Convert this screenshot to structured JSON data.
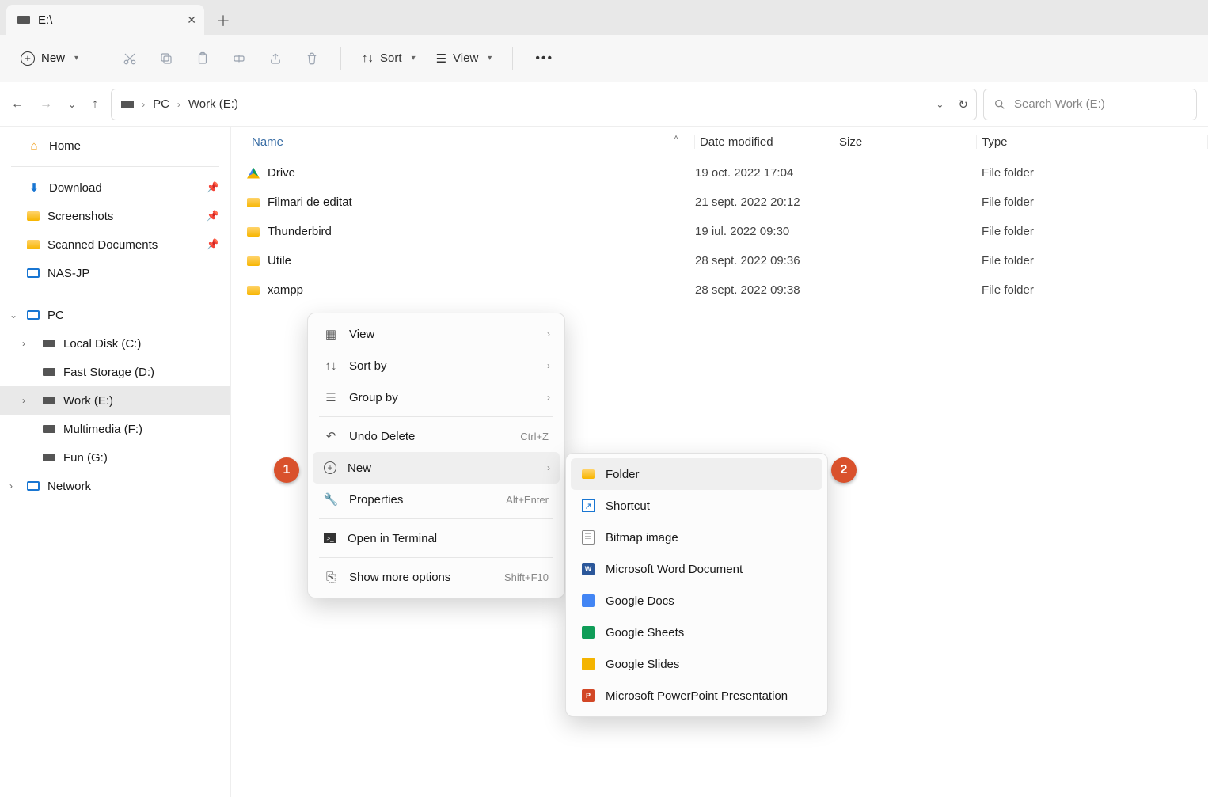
{
  "tab": {
    "title": "E:\\"
  },
  "toolbar": {
    "new_label": "New",
    "sort_label": "Sort",
    "view_label": "View"
  },
  "breadcrumb": {
    "pc": "PC",
    "drive": "Work (E:)"
  },
  "search": {
    "placeholder": "Search Work (E:)"
  },
  "sidebar": {
    "home": "Home",
    "quick": [
      {
        "label": "Download"
      },
      {
        "label": "Screenshots"
      },
      {
        "label": "Scanned Documents"
      },
      {
        "label": "NAS-JP"
      }
    ],
    "pc": "PC",
    "drives": [
      {
        "label": "Local Disk (C:)"
      },
      {
        "label": "Fast Storage (D:)"
      },
      {
        "label": "Work (E:)"
      },
      {
        "label": "Multimedia (F:)"
      },
      {
        "label": "Fun (G:)"
      }
    ],
    "network": "Network"
  },
  "columns": {
    "name": "Name",
    "date": "Date modified",
    "size": "Size",
    "type": "Type"
  },
  "rows": [
    {
      "name": "Drive",
      "date": "19 oct. 2022 17:04",
      "type": "File folder",
      "icon": "gdrive"
    },
    {
      "name": "Filmari de editat",
      "date": "21 sept. 2022 20:12",
      "type": "File folder",
      "icon": "folder"
    },
    {
      "name": "Thunderbird",
      "date": "19 iul. 2022 09:30",
      "type": "File folder",
      "icon": "folder"
    },
    {
      "name": "Utile",
      "date": "28 sept. 2022 09:36",
      "type": "File folder",
      "icon": "folder"
    },
    {
      "name": "xampp",
      "date": "28 sept. 2022 09:38",
      "type": "File folder",
      "icon": "folder"
    }
  ],
  "ctx": {
    "view": "View",
    "sort_by": "Sort by",
    "group_by": "Group by",
    "undo": "Undo Delete",
    "undo_sc": "Ctrl+Z",
    "new": "New",
    "properties": "Properties",
    "properties_sc": "Alt+Enter",
    "terminal": "Open in Terminal",
    "more": "Show more options",
    "more_sc": "Shift+F10"
  },
  "submenu": {
    "folder": "Folder",
    "shortcut": "Shortcut",
    "bitmap": "Bitmap image",
    "word": "Microsoft Word Document",
    "gdocs": "Google Docs",
    "gsheets": "Google Sheets",
    "gslides": "Google Slides",
    "ppt": "Microsoft PowerPoint Presentation"
  },
  "callouts": {
    "one": "1",
    "two": "2"
  }
}
